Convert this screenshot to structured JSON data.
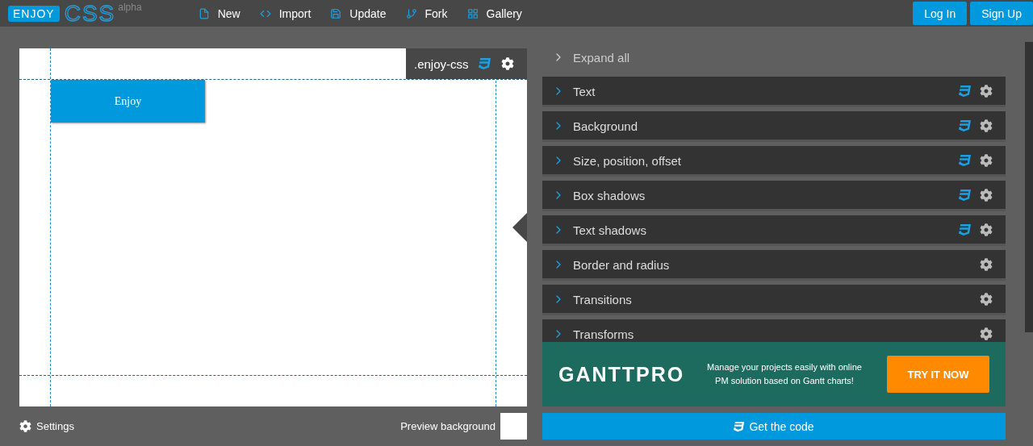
{
  "logo": {
    "badge": "ENJOY",
    "word": "CSS",
    "tag": "alpha"
  },
  "nav": [
    {
      "kind": "file",
      "label": "New"
    },
    {
      "kind": "import",
      "label": "Import"
    },
    {
      "kind": "save",
      "label": "Update"
    },
    {
      "kind": "fork",
      "label": "Fork"
    },
    {
      "kind": "grid",
      "label": "Gallery"
    }
  ],
  "auth": [
    "Log In",
    "Sign Up"
  ],
  "preview": {
    "selector": ".enjoy-css",
    "element_text": "Enjoy"
  },
  "expand_all": "Expand all",
  "sections": [
    {
      "label": "Text",
      "css3": true,
      "expanded": false
    },
    {
      "label": "Background",
      "css3": true,
      "expanded": false
    },
    {
      "label": "Size, position, offset",
      "css3": true,
      "expanded": false
    },
    {
      "label": "Box shadows",
      "css3": true,
      "expanded": false
    },
    {
      "label": "Text shadows",
      "css3": true,
      "expanded": false
    },
    {
      "label": "Border and radius",
      "css3": false,
      "expanded": false
    },
    {
      "label": "Transitions",
      "css3": false,
      "expanded": false
    },
    {
      "label": "Transforms",
      "css3": false,
      "expanded": false
    }
  ],
  "ad": {
    "brand": "GANTTPRO",
    "text": "Manage your projects easily with online PM solution based on Gantt charts!",
    "cta": "TRY IT NOW"
  },
  "settings": "Settings",
  "preview_background": "Preview background",
  "get_code": "Get the code"
}
